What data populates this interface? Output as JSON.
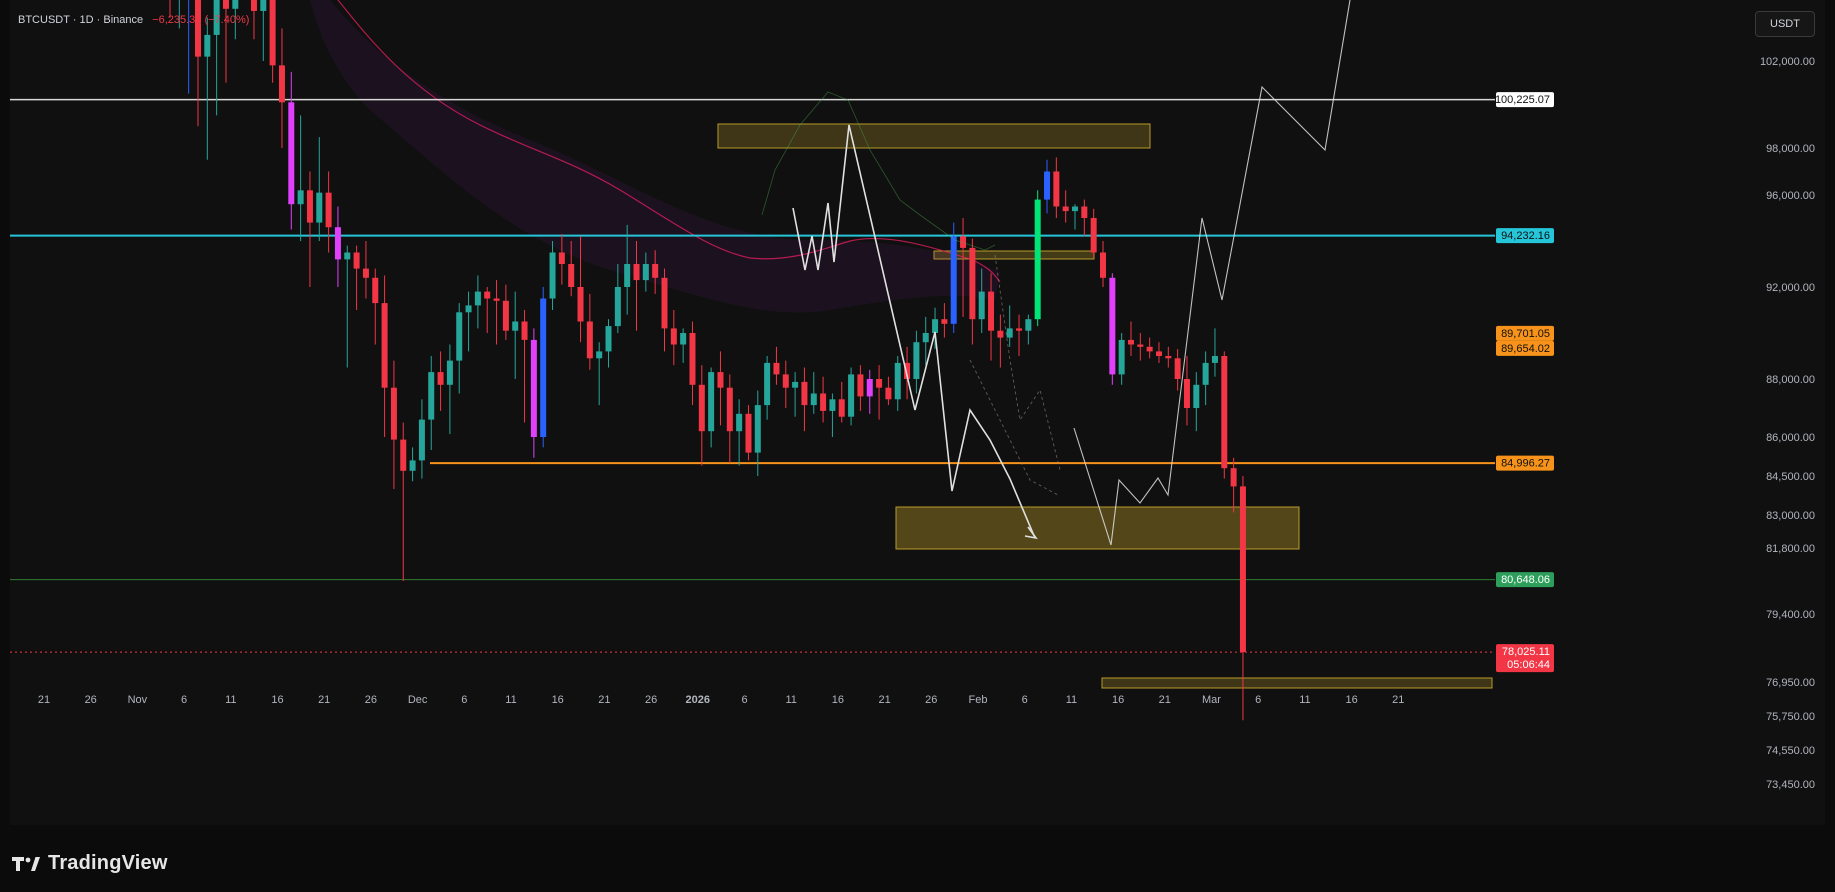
{
  "header": {
    "symbol_label": "BTCUSDT · 1D · Binance",
    "change_label": "−6,235.36 (−7.40%)"
  },
  "currency_button": "USDT",
  "brand": {
    "name": "TradingView"
  },
  "colors": {
    "background": "#101010",
    "bull": "#26a69a",
    "bear": "#f23645",
    "highlight_bull": "#2962ff",
    "highlight_bear": "#e040fb",
    "impulse": "#00e676",
    "zone": "#b89a2a",
    "cyan_line": "#26c6da",
    "orange_line": "#f7931a",
    "green_line": "#2e7d32",
    "ma_line": "#e91e63"
  },
  "chart_data": {
    "type": "candlestick",
    "timeframe": "1D",
    "y_axis_ticks": [
      "102,000.00",
      "98,000.00",
      "96,000.00",
      "92,000.00",
      "88,000.00",
      "86,000.00",
      "84,500.00",
      "83,000.00",
      "81,800.00",
      "79,400.00",
      "76,950.00",
      "75,750.00",
      "74,550.00",
      "73,450.00"
    ],
    "x_axis_ticks": [
      "21",
      "26",
      "Nov",
      "6",
      "11",
      "16",
      "21",
      "26",
      "Dec",
      "6",
      "11",
      "16",
      "21",
      "26",
      "2026",
      "6",
      "11",
      "16",
      "21",
      "26",
      "Feb",
      "6",
      "11",
      "16",
      "21",
      "Mar",
      "6",
      "11",
      "16",
      "21"
    ],
    "price_labels": [
      {
        "label": "100,225.07",
        "value": 100225.07,
        "style": "white"
      },
      {
        "label": "94,232.16",
        "value": 94232.16,
        "style": "cyan"
      },
      {
        "label": "89,701.05",
        "value": 89701.05,
        "style": "orange"
      },
      {
        "label": "89,654.02",
        "value": 89654.02,
        "style": "orange"
      },
      {
        "label": "84,996.27",
        "value": 84996.27,
        "style": "orange"
      },
      {
        "label": "80,648.06",
        "value": 80648.06,
        "style": "green"
      },
      {
        "label": "78,025.11",
        "sublabel": "05:06:44",
        "value": 78025.11,
        "style": "red"
      }
    ],
    "horizontal_lines": [
      {
        "name": "resistance",
        "value": 100225.07,
        "color": "#d8d8d8"
      },
      {
        "name": "pivot",
        "value": 94232.16,
        "color": "#26c6da"
      },
      {
        "name": "support",
        "value": 84996.27,
        "color": "#f7931a"
      },
      {
        "name": "low",
        "value": 80648.06,
        "color": "#2e7d32"
      },
      {
        "name": "last-price",
        "value": 78025.11,
        "color": "#f23645"
      }
    ],
    "candles": [
      {
        "d": "2025-11-02",
        "o": 110600,
        "h": 112000,
        "l": 104000,
        "c": 105800
      },
      {
        "d": "2025-11-03",
        "o": 105800,
        "h": 111500,
        "l": 103500,
        "c": 110500
      },
      {
        "d": "2025-11-04",
        "o": 110400,
        "h": 112000,
        "l": 100500,
        "c": 107300,
        "hl": "bull"
      },
      {
        "d": "2025-11-05",
        "o": 107300,
        "h": 109000,
        "l": 99000,
        "c": 102200
      },
      {
        "d": "2025-11-06",
        "o": 102200,
        "h": 104000,
        "l": 97500,
        "c": 103200
      },
      {
        "d": "2025-11-07",
        "o": 103200,
        "h": 107200,
        "l": 99500,
        "c": 106300
      },
      {
        "d": "2025-11-08",
        "o": 106300,
        "h": 106800,
        "l": 101000,
        "c": 104400
      },
      {
        "d": "2025-11-09",
        "o": 104400,
        "h": 111000,
        "l": 103000,
        "c": 108500
      },
      {
        "d": "2025-11-10",
        "o": 108500,
        "h": 115000,
        "l": 107000,
        "c": 113000
      },
      {
        "d": "2025-11-11",
        "o": 113000,
        "h": 114500,
        "l": 103000,
        "c": 104300
      },
      {
        "d": "2025-11-12",
        "o": 104300,
        "h": 107500,
        "l": 102000,
        "c": 105300
      },
      {
        "d": "2025-11-13",
        "o": 105300,
        "h": 109000,
        "l": 101000,
        "c": 101800
      },
      {
        "d": "2025-11-14",
        "o": 101800,
        "h": 103500,
        "l": 98000,
        "c": 100100
      },
      {
        "d": "2025-11-15",
        "o": 100100,
        "h": 101500,
        "l": 94500,
        "c": 95600,
        "hl": "bear"
      },
      {
        "d": "2025-11-16",
        "o": 95600,
        "h": 99500,
        "l": 94000,
        "c": 96200
      },
      {
        "d": "2025-11-17",
        "o": 96200,
        "h": 97000,
        "l": 92000,
        "c": 94800
      },
      {
        "d": "2025-11-18",
        "o": 94800,
        "h": 98500,
        "l": 94000,
        "c": 96100
      },
      {
        "d": "2025-11-19",
        "o": 96100,
        "h": 97000,
        "l": 93500,
        "c": 94600
      },
      {
        "d": "2025-11-20",
        "o": 94600,
        "h": 95500,
        "l": 92000,
        "c": 93200,
        "hl": "bear"
      },
      {
        "d": "2025-11-21",
        "o": 93200,
        "h": 93800,
        "l": 88500,
        "c": 93500
      },
      {
        "d": "2025-11-22",
        "o": 93500,
        "h": 93800,
        "l": 91000,
        "c": 92800
      },
      {
        "d": "2025-11-23",
        "o": 92800,
        "h": 94000,
        "l": 91500,
        "c": 92400
      },
      {
        "d": "2025-11-24",
        "o": 92400,
        "h": 92800,
        "l": 89500,
        "c": 91300
      },
      {
        "d": "2025-11-25",
        "o": 91300,
        "h": 92500,
        "l": 86000,
        "c": 87700
      },
      {
        "d": "2025-11-26",
        "o": 87700,
        "h": 88800,
        "l": 84000,
        "c": 85900
      },
      {
        "d": "2025-11-27",
        "o": 85900,
        "h": 86500,
        "l": 80600,
        "c": 84700
      },
      {
        "d": "2025-11-28",
        "o": 84700,
        "h": 85600,
        "l": 84300,
        "c": 85100
      },
      {
        "d": "2025-11-29",
        "o": 85100,
        "h": 87300,
        "l": 84400,
        "c": 86600
      },
      {
        "d": "2025-11-30",
        "o": 86600,
        "h": 89000,
        "l": 85500,
        "c": 88300
      },
      {
        "d": "2025-12-01",
        "o": 88300,
        "h": 89200,
        "l": 86900,
        "c": 87800
      },
      {
        "d": "2025-12-02",
        "o": 87800,
        "h": 89500,
        "l": 86100,
        "c": 88800
      },
      {
        "d": "2025-12-03",
        "o": 88800,
        "h": 91300,
        "l": 87500,
        "c": 90900
      },
      {
        "d": "2025-12-04",
        "o": 90900,
        "h": 91800,
        "l": 89200,
        "c": 91200
      },
      {
        "d": "2025-12-05",
        "o": 91200,
        "h": 92500,
        "l": 90200,
        "c": 91800
      },
      {
        "d": "2025-12-06",
        "o": 91800,
        "h": 92000,
        "l": 90000,
        "c": 91500
      },
      {
        "d": "2025-12-07",
        "o": 91500,
        "h": 92300,
        "l": 89500,
        "c": 91400
      },
      {
        "d": "2025-12-08",
        "o": 91400,
        "h": 92100,
        "l": 89700,
        "c": 90100
      },
      {
        "d": "2025-12-09",
        "o": 90100,
        "h": 91800,
        "l": 88000,
        "c": 90500
      },
      {
        "d": "2025-12-10",
        "o": 90500,
        "h": 91000,
        "l": 86500,
        "c": 89700
      },
      {
        "d": "2025-12-11",
        "o": 89700,
        "h": 90200,
        "l": 85200,
        "c": 86000,
        "hl": "bear"
      },
      {
        "d": "2025-12-12",
        "o": 86000,
        "h": 92000,
        "l": 85600,
        "c": 91500,
        "hl": "bull"
      },
      {
        "d": "2025-12-13",
        "o": 91500,
        "h": 94000,
        "l": 91000,
        "c": 93500
      },
      {
        "d": "2025-12-14",
        "o": 93500,
        "h": 94300,
        "l": 92100,
        "c": 93000
      },
      {
        "d": "2025-12-15",
        "o": 93000,
        "h": 94000,
        "l": 91600,
        "c": 92000
      },
      {
        "d": "2025-12-16",
        "o": 92000,
        "h": 94200,
        "l": 89600,
        "c": 90500
      },
      {
        "d": "2025-12-17",
        "o": 90500,
        "h": 91700,
        "l": 88400,
        "c": 88900
      },
      {
        "d": "2025-12-18",
        "o": 88900,
        "h": 89600,
        "l": 87100,
        "c": 89200
      },
      {
        "d": "2025-12-19",
        "o": 89200,
        "h": 90600,
        "l": 88500,
        "c": 90300
      },
      {
        "d": "2025-12-20",
        "o": 90300,
        "h": 93000,
        "l": 90000,
        "c": 92000
      },
      {
        "d": "2025-12-21",
        "o": 92000,
        "h": 94700,
        "l": 90800,
        "c": 93000
      },
      {
        "d": "2025-12-22",
        "o": 93000,
        "h": 94000,
        "l": 90100,
        "c": 92300
      },
      {
        "d": "2025-12-23",
        "o": 92300,
        "h": 93500,
        "l": 91800,
        "c": 93000
      },
      {
        "d": "2025-12-24",
        "o": 93000,
        "h": 93600,
        "l": 91700,
        "c": 92400
      },
      {
        "d": "2025-12-25",
        "o": 92400,
        "h": 92800,
        "l": 89200,
        "c": 90200
      },
      {
        "d": "2025-12-26",
        "o": 90200,
        "h": 91000,
        "l": 88600,
        "c": 89500
      },
      {
        "d": "2025-12-27",
        "o": 89500,
        "h": 90200,
        "l": 88700,
        "c": 90000
      },
      {
        "d": "2025-12-28",
        "o": 90000,
        "h": 90500,
        "l": 87100,
        "c": 87800
      },
      {
        "d": "2025-12-29",
        "o": 87800,
        "h": 88600,
        "l": 84900,
        "c": 86200
      },
      {
        "d": "2025-12-30",
        "o": 86200,
        "h": 88500,
        "l": 85600,
        "c": 88300
      },
      {
        "d": "2025-12-31",
        "o": 88300,
        "h": 89200,
        "l": 86400,
        "c": 87700
      },
      {
        "d": "2026-01-01",
        "o": 87700,
        "h": 88200,
        "l": 85000,
        "c": 86200
      },
      {
        "d": "2026-01-02",
        "o": 86200,
        "h": 87300,
        "l": 84900,
        "c": 86800
      },
      {
        "d": "2026-01-03",
        "o": 86800,
        "h": 87100,
        "l": 85100,
        "c": 85400
      },
      {
        "d": "2026-01-04",
        "o": 85400,
        "h": 87600,
        "l": 84500,
        "c": 87100
      },
      {
        "d": "2026-01-05",
        "o": 87100,
        "h": 89000,
        "l": 86600,
        "c": 88700
      },
      {
        "d": "2026-01-06",
        "o": 88700,
        "h": 89400,
        "l": 87800,
        "c": 88200
      },
      {
        "d": "2026-01-07",
        "o": 88200,
        "h": 88800,
        "l": 87000,
        "c": 87700
      },
      {
        "d": "2026-01-08",
        "o": 87700,
        "h": 88300,
        "l": 86700,
        "c": 87900
      },
      {
        "d": "2026-01-09",
        "o": 87900,
        "h": 88500,
        "l": 86200,
        "c": 87100
      },
      {
        "d": "2026-01-10",
        "o": 87100,
        "h": 88300,
        "l": 86800,
        "c": 87500
      },
      {
        "d": "2026-01-11",
        "o": 87500,
        "h": 88100,
        "l": 86500,
        "c": 86900
      },
      {
        "d": "2026-01-12",
        "o": 86900,
        "h": 87500,
        "l": 86000,
        "c": 87300
      },
      {
        "d": "2026-01-13",
        "o": 87300,
        "h": 87900,
        "l": 86500,
        "c": 86700
      },
      {
        "d": "2026-01-14",
        "o": 86700,
        "h": 88500,
        "l": 86400,
        "c": 88200
      },
      {
        "d": "2026-01-15",
        "o": 88200,
        "h": 88600,
        "l": 86900,
        "c": 87400
      },
      {
        "d": "2026-01-16",
        "o": 87400,
        "h": 88400,
        "l": 86800,
        "c": 88000,
        "hl": "bear"
      },
      {
        "d": "2026-01-17",
        "o": 88000,
        "h": 88600,
        "l": 86600,
        "c": 87700
      },
      {
        "d": "2026-01-18",
        "o": 87700,
        "h": 88100,
        "l": 87100,
        "c": 87300
      },
      {
        "d": "2026-01-19",
        "o": 87300,
        "h": 89000,
        "l": 86900,
        "c": 88700
      },
      {
        "d": "2026-01-20",
        "o": 88700,
        "h": 89400,
        "l": 87300,
        "c": 88000
      },
      {
        "d": "2026-01-21",
        "o": 88000,
        "h": 90100,
        "l": 87500,
        "c": 89600
      },
      {
        "d": "2026-01-22",
        "o": 89600,
        "h": 90700,
        "l": 88600,
        "c": 90000
      },
      {
        "d": "2026-01-23",
        "o": 90000,
        "h": 91100,
        "l": 89300,
        "c": 90600
      },
      {
        "d": "2026-01-24",
        "o": 90600,
        "h": 91300,
        "l": 89800,
        "c": 90400
      },
      {
        "d": "2026-01-25",
        "o": 90400,
        "h": 94800,
        "l": 90000,
        "c": 94200,
        "hl": "bull"
      },
      {
        "d": "2026-01-26",
        "o": 94200,
        "h": 95000,
        "l": 90700,
        "c": 93700
      },
      {
        "d": "2026-01-27",
        "o": 93700,
        "h": 94100,
        "l": 89500,
        "c": 90600
      },
      {
        "d": "2026-01-28",
        "o": 90600,
        "h": 92800,
        "l": 90000,
        "c": 91800
      },
      {
        "d": "2026-01-29",
        "o": 91800,
        "h": 92600,
        "l": 88800,
        "c": 90100
      },
      {
        "d": "2026-01-30",
        "o": 90100,
        "h": 90800,
        "l": 88500,
        "c": 89800
      },
      {
        "d": "2026-01-31",
        "o": 89800,
        "h": 91200,
        "l": 89400,
        "c": 90200
      },
      {
        "d": "2026-02-01",
        "o": 90200,
        "h": 90800,
        "l": 89000,
        "c": 90100
      },
      {
        "d": "2026-02-02",
        "o": 90100,
        "h": 90800,
        "l": 89500,
        "c": 90600
      },
      {
        "d": "2026-02-03",
        "o": 90600,
        "h": 96200,
        "l": 90300,
        "c": 95800,
        "hl": "impulse"
      },
      {
        "d": "2026-02-04",
        "o": 95800,
        "h": 97500,
        "l": 95200,
        "c": 97000,
        "hl": "bull"
      },
      {
        "d": "2026-02-05",
        "o": 97000,
        "h": 97600,
        "l": 95000,
        "c": 95500
      },
      {
        "d": "2026-02-06",
        "o": 95500,
        "h": 96200,
        "l": 94800,
        "c": 95300
      },
      {
        "d": "2026-02-07",
        "o": 95300,
        "h": 95600,
        "l": 94500,
        "c": 95500
      },
      {
        "d": "2026-02-08",
        "o": 95500,
        "h": 95800,
        "l": 94200,
        "c": 95000
      },
      {
        "d": "2026-02-09",
        "o": 95000,
        "h": 95400,
        "l": 93300,
        "c": 93500
      },
      {
        "d": "2026-02-10",
        "o": 93500,
        "h": 94000,
        "l": 92000,
        "c": 92400
      },
      {
        "d": "2026-02-11",
        "o": 92400,
        "h": 92600,
        "l": 87800,
        "c": 88200,
        "hl": "bear"
      },
      {
        "d": "2026-02-12",
        "o": 88200,
        "h": 90000,
        "l": 87800,
        "c": 89700
      },
      {
        "d": "2026-02-13",
        "o": 89700,
        "h": 90500,
        "l": 89000,
        "c": 89500
      },
      {
        "d": "2026-02-14",
        "o": 89500,
        "h": 90000,
        "l": 88800,
        "c": 89400
      },
      {
        "d": "2026-02-15",
        "o": 89400,
        "h": 89800,
        "l": 88900,
        "c": 89200
      },
      {
        "d": "2026-02-16",
        "o": 89200,
        "h": 89600,
        "l": 88700,
        "c": 89000
      },
      {
        "d": "2026-02-17",
        "o": 89000,
        "h": 89400,
        "l": 88500,
        "c": 88900
      },
      {
        "d": "2026-02-18",
        "o": 88900,
        "h": 89300,
        "l": 87600,
        "c": 88000
      },
      {
        "d": "2026-02-19",
        "o": 88000,
        "h": 89000,
        "l": 86400,
        "c": 87000
      },
      {
        "d": "2026-02-20",
        "o": 87000,
        "h": 88300,
        "l": 86200,
        "c": 87800
      },
      {
        "d": "2026-02-21",
        "o": 87800,
        "h": 89200,
        "l": 87100,
        "c": 88700
      },
      {
        "d": "2026-02-22",
        "o": 88700,
        "h": 90200,
        "l": 88100,
        "c": 89000
      },
      {
        "d": "2026-02-23",
        "o": 89000,
        "h": 89200,
        "l": 84400,
        "c": 84800
      },
      {
        "d": "2026-02-24",
        "o": 84800,
        "h": 85200,
        "l": 83100,
        "c": 84100
      },
      {
        "d": "2026-02-25",
        "o": 84100,
        "h": 84500,
        "l": 75600,
        "c": 78025.11
      }
    ]
  }
}
